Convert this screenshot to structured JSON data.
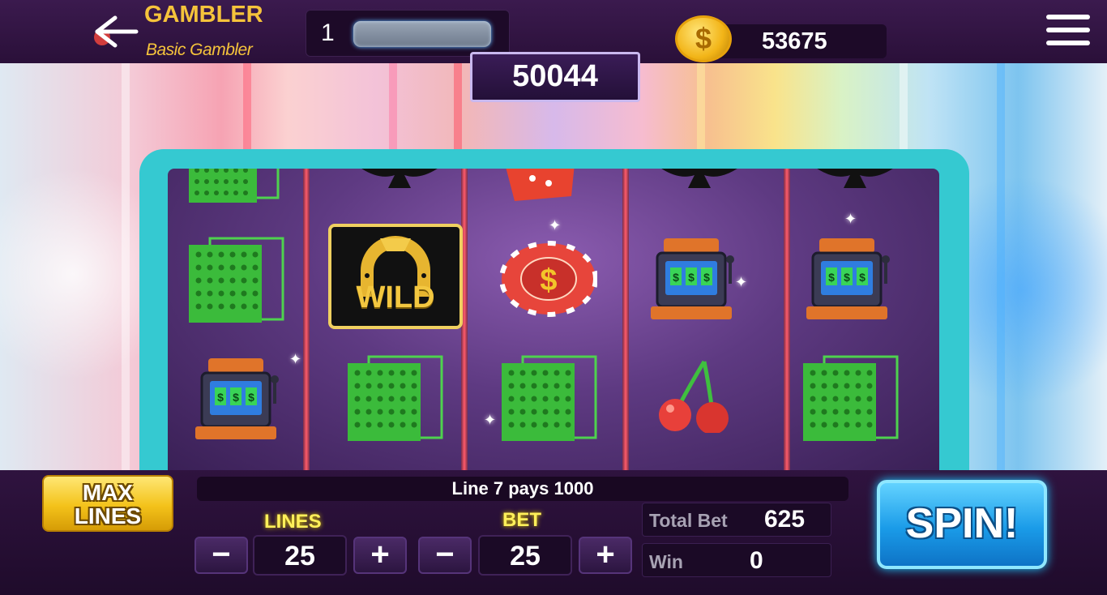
{
  "header": {
    "title": "GAMBLER",
    "subtitle": "Basic Gambler",
    "level": "1",
    "coins": "53675",
    "icons": {
      "back": "back-arrow-icon",
      "coin": "dollar-coin-icon",
      "menu": "hamburger-menu-icon"
    }
  },
  "jackpot": "50044",
  "reels": {
    "symbols": [
      [
        "card-deck",
        "card-deck",
        "slot-machine"
      ],
      [
        "spade",
        "wild",
        "card-deck"
      ],
      [
        "dice",
        "poker-chip",
        "card-deck"
      ],
      [
        "spade",
        "slot-machine",
        "cherry"
      ],
      [
        "spade",
        "slot-machine",
        "card-deck"
      ]
    ],
    "wild_text": "WILD",
    "slot_machine_text": "$$$",
    "chip_text": "$"
  },
  "controls": {
    "max_lines": [
      "MAX",
      "LINES"
    ],
    "message": "Line 7 pays 1000",
    "lines_label": "LINES",
    "lines_value": "25",
    "bet_label": "BET",
    "bet_value": "25",
    "minus": "−",
    "plus": "+",
    "total_bet_label": "Total Bet",
    "total_bet_value": "625",
    "win_label": "Win",
    "win_value": "0",
    "spin_label": "SPIN!"
  },
  "colors": {
    "gold": "#f5c33b",
    "frame": "#35c9d1",
    "spin": "#1a9be8",
    "panel": "#2a1039"
  }
}
